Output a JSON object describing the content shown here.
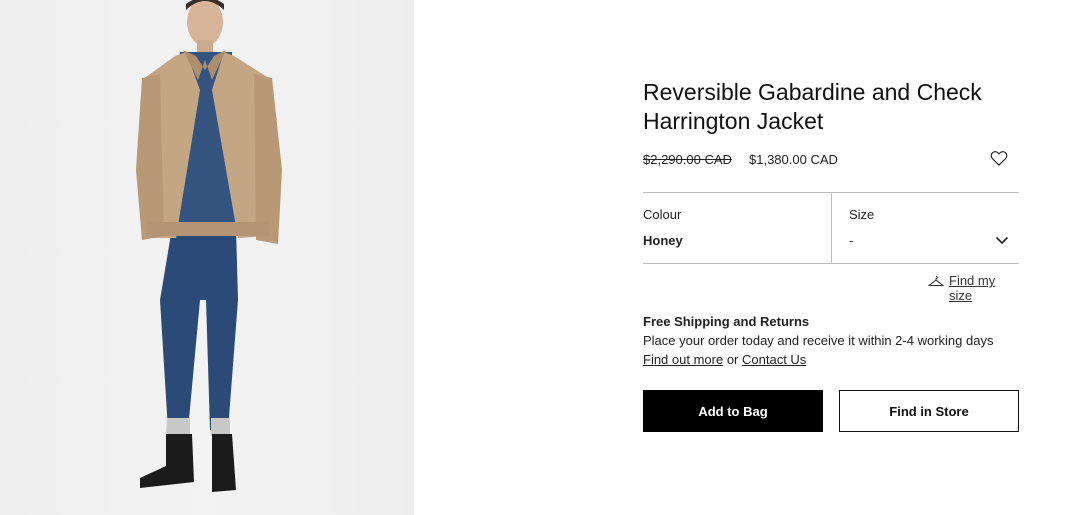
{
  "product": {
    "title_line1": "Reversible Gabardine and Check",
    "title_line2": "Harrington Jacket",
    "price_original": "$2,290.00 CAD",
    "price_sale": "$1,380.00 CAD"
  },
  "selector": {
    "colour_label": "Colour",
    "colour_value": "Honey",
    "size_label": "Size",
    "size_value": "-"
  },
  "fit": {
    "link_text": "Find my size"
  },
  "shipping": {
    "title": "Free Shipping and Returns",
    "body": "Place your order today and receive it within 2-4 working days",
    "link_more": "Find out more",
    "connector": " or ",
    "link_contact": "Contact Us"
  },
  "actions": {
    "add_to_bag": "Add to Bag",
    "find_in_store": "Find in Store"
  },
  "icons": {
    "wishlist": "heart-icon",
    "size_dropdown": "chevron-down-icon",
    "fit": "hanger-icon"
  },
  "colors": {
    "primary_button": "#000000",
    "divider": "#bdbdbd",
    "image_background": "#eeeeee"
  }
}
